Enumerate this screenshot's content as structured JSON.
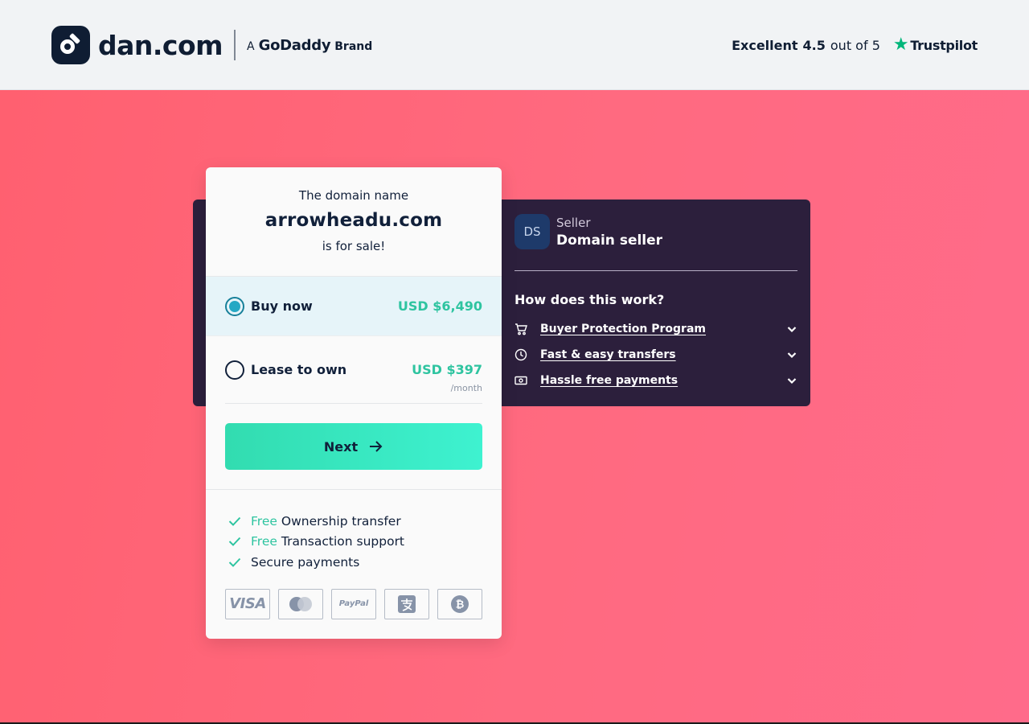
{
  "header": {
    "logo_text": "dan.com",
    "brand_prefix": "A",
    "brand_name": "GoDaddy",
    "brand_suffix": "Brand",
    "rating_word": "Excellent",
    "rating_value": "4.5",
    "rating_suffix": "out of 5",
    "trust_brand": "Trustpilot"
  },
  "card": {
    "intro": "The domain name",
    "domain": "arrowheadu.com",
    "outro": "is for sale!",
    "options": [
      {
        "label": "Buy now",
        "price": "USD $6,490",
        "selected": true
      },
      {
        "label": "Lease to own",
        "price": "USD $397",
        "period": "/month",
        "selected": false
      }
    ],
    "next_label": "Next",
    "features": [
      {
        "free": "Free",
        "text": "Ownership transfer"
      },
      {
        "free": "Free",
        "text": "Transaction support"
      },
      {
        "free": "",
        "text": "Secure payments"
      }
    ],
    "payment_methods": [
      {
        "icon": "visa-icon",
        "label": "VISA"
      },
      {
        "icon": "mastercard-icon",
        "label": ""
      },
      {
        "icon": "paypal-icon",
        "label": "PayPal"
      },
      {
        "icon": "alipay-icon",
        "label": ""
      },
      {
        "icon": "bitcoin-icon",
        "label": ""
      }
    ]
  },
  "seller": {
    "initials": "DS",
    "label": "Seller",
    "name": "Domain seller"
  },
  "how": {
    "title": "How does this work?",
    "items": [
      {
        "icon": "cart-icon",
        "label": "Buyer Protection Program"
      },
      {
        "icon": "clock-icon",
        "label": "Fast & easy transfers"
      },
      {
        "icon": "cash-icon",
        "label": "Hassle free payments"
      }
    ]
  },
  "colors": {
    "accent": "#2ec4a0",
    "hero_start": "#ff6070",
    "hero_end": "#ff6b8a",
    "panel": "#2c1f3c",
    "dark": "#0f1d33"
  }
}
